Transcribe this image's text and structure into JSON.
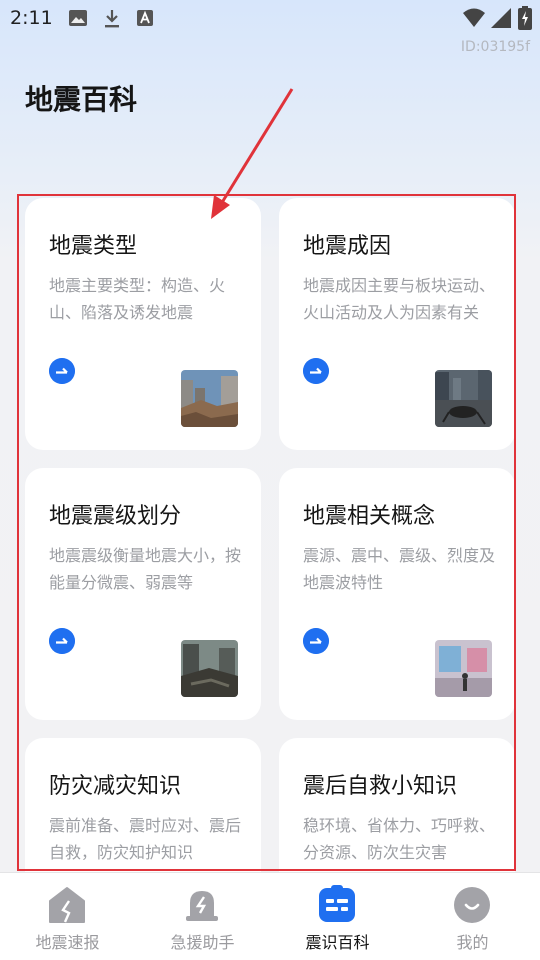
{
  "status_bar": {
    "time": "2:11",
    "device_id": "ID:03195f"
  },
  "page": {
    "title": "地震百科"
  },
  "cards": [
    {
      "title": "地震类型",
      "desc": "地震主要类型：构造、火山、陷落及诱发地震"
    },
    {
      "title": "地震成因",
      "desc": "地震成因主要与板块运动、火山活动及人为因素有关"
    },
    {
      "title": "地震震级划分",
      "desc": "地震震级衡量地震大小，按能量分微震、弱震等"
    },
    {
      "title": "地震相关概念",
      "desc": "震源、震中、震级、烈度及地震波特性"
    },
    {
      "title": "防灾减灾知识",
      "desc": "震前准备、震时应对、震后自救，防灾知护知识"
    },
    {
      "title": "震后自救小知识",
      "desc": "稳环境、省体力、巧呼救、分资源、防次生灾害"
    }
  ],
  "nav": [
    {
      "label": "地震速报",
      "icon": "house-icon",
      "active": false
    },
    {
      "label": "急援助手",
      "icon": "alert-bell-icon",
      "active": false
    },
    {
      "label": "震识百科",
      "icon": "encyclopedia-icon",
      "active": true
    },
    {
      "label": "我的",
      "icon": "profile-smile-icon",
      "active": false
    }
  ],
  "colors": {
    "accent": "#1f6ff0",
    "highlight": "#e0333a",
    "inactive_nav": "#9a9a9e"
  }
}
